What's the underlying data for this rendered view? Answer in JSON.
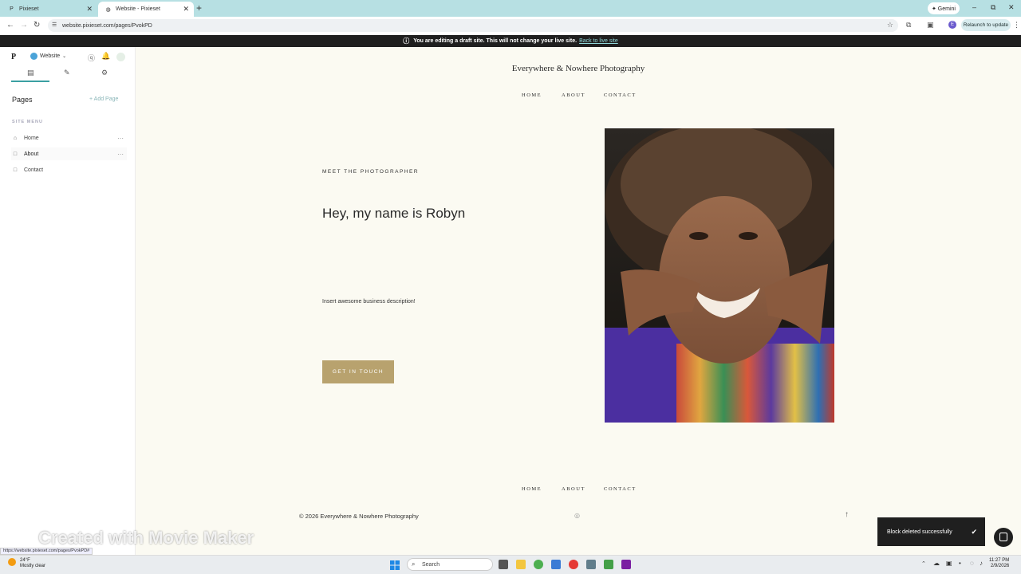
{
  "browser": {
    "tabs": [
      {
        "label": "Pixieset",
        "icon": "P"
      },
      {
        "label": "Website - Pixieset",
        "icon": "◍"
      }
    ],
    "close_glyph": "✕",
    "new_tab_glyph": "+",
    "gemini_label": "✦ Gemini",
    "url": "website.pixieset.com/pages/PvokPD",
    "relaunch_label": "Relaunch to update",
    "profile_initial": "E"
  },
  "banner": {
    "message": "You are editing a draft site. This will not change your live site.",
    "link": "Back to live site"
  },
  "sidebar": {
    "logo": "P",
    "site_selector": "Website",
    "pages_heading": "Pages",
    "add_page": "+ Add Page",
    "site_menu_label": "SITE MENU",
    "items": [
      {
        "label": "Home",
        "icon": "⌂"
      },
      {
        "label": "About",
        "icon": "□"
      },
      {
        "label": "Contact",
        "icon": "□"
      }
    ]
  },
  "site": {
    "title": "Everywhere & Nowhere Photography",
    "nav": [
      "HOME",
      "ABOUT",
      "CONTACT"
    ],
    "eyebrow": "MEET THE PHOTOGRAPHER",
    "headline": "Hey, my name is Robyn",
    "description": "Insert awesome business description!",
    "cta": "GET IN TOUCH",
    "footer_nav": [
      "HOME",
      "ABOUT",
      "CONTACT"
    ],
    "copyright": "© 2026 Everywhere & Nowhere Photography"
  },
  "toast": {
    "message": "Block deleted successfully"
  },
  "watermark": "Created with Movie Maker",
  "status_url": "https://website.pixieset.com/pages/PvokPD#",
  "taskbar": {
    "weather_temp": "24°F",
    "weather_desc": "Mostly clear",
    "search_placeholder": "Search",
    "time": "11:27 PM",
    "date": "2/9/2026"
  },
  "colors": {
    "accent": "#b8a26e",
    "banner_bg": "#1f1f1f",
    "site_bg": "#fbfaf2"
  }
}
